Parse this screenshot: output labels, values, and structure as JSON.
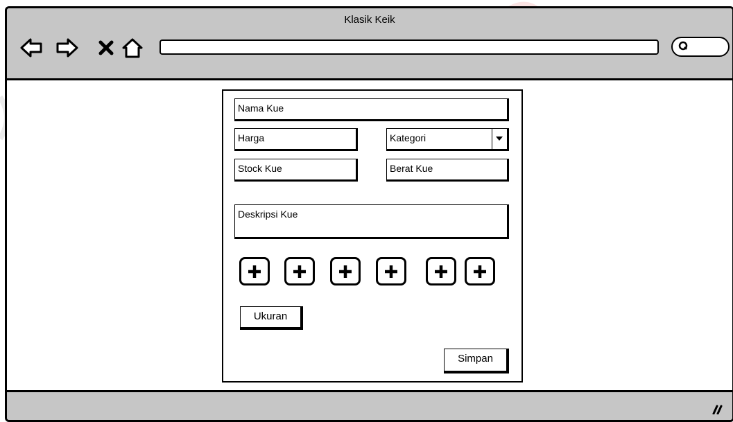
{
  "window": {
    "title": "Klasik Keik"
  },
  "toolbar": {
    "back_icon": "back-arrow-icon",
    "forward_icon": "forward-arrow-icon",
    "stop_icon": "close-icon",
    "home_icon": "home-icon",
    "search_icon": "search-icon"
  },
  "form": {
    "nama_kue": "Nama Kue",
    "harga": "Harga",
    "kategori": "Kategori",
    "stock_kue": "Stock Kue",
    "berat_kue": "Berat Kue",
    "deskripsi_kue": "Deskripsi Kue",
    "add_image_buttons": [
      "+",
      "+",
      "+",
      "+",
      "+",
      "+"
    ],
    "ukuran_label": "Ukuran",
    "simpan_label": "Simpan"
  },
  "colors": {
    "chrome": "#c6c6c6",
    "border": "#000000",
    "background": "#ffffff"
  }
}
